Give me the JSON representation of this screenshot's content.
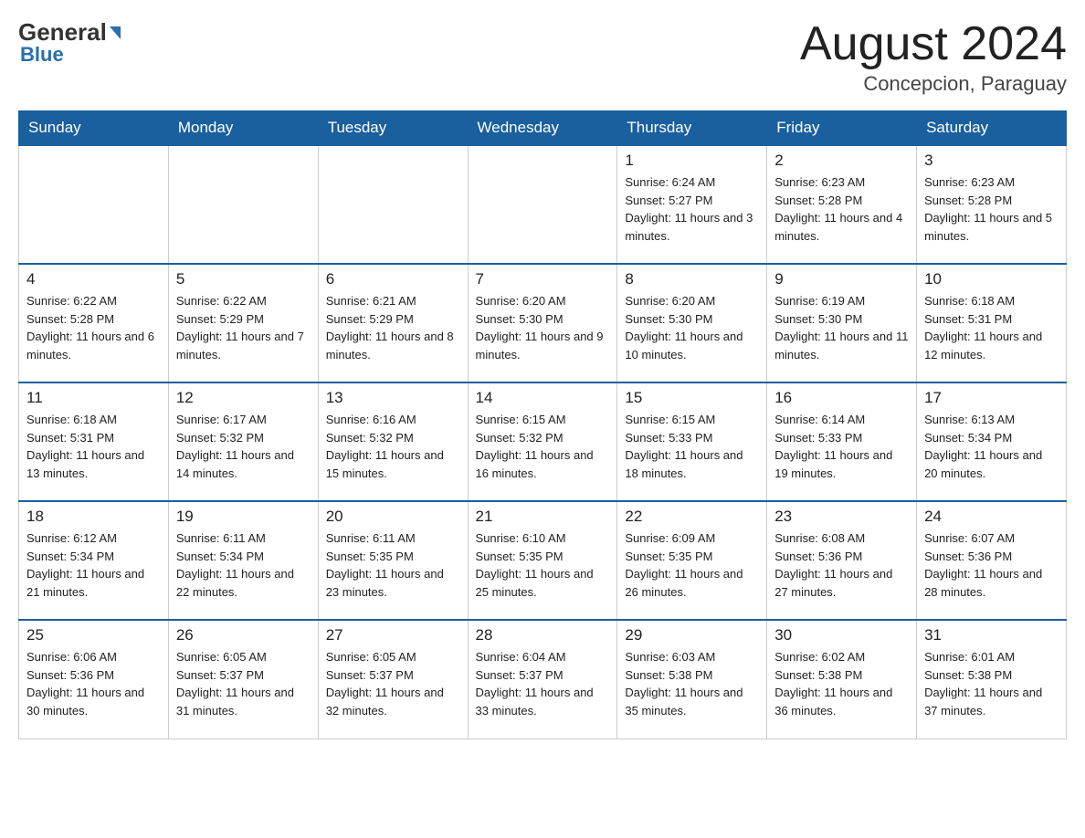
{
  "header": {
    "logo_general": "General",
    "logo_blue": "Blue",
    "month_year": "August 2024",
    "location": "Concepcion, Paraguay"
  },
  "weekdays": [
    "Sunday",
    "Monday",
    "Tuesday",
    "Wednesday",
    "Thursday",
    "Friday",
    "Saturday"
  ],
  "weeks": [
    [
      {
        "day": "",
        "sunrise": "",
        "sunset": "",
        "daylight": ""
      },
      {
        "day": "",
        "sunrise": "",
        "sunset": "",
        "daylight": ""
      },
      {
        "day": "",
        "sunrise": "",
        "sunset": "",
        "daylight": ""
      },
      {
        "day": "",
        "sunrise": "",
        "sunset": "",
        "daylight": ""
      },
      {
        "day": "1",
        "sunrise": "Sunrise: 6:24 AM",
        "sunset": "Sunset: 5:27 PM",
        "daylight": "Daylight: 11 hours and 3 minutes."
      },
      {
        "day": "2",
        "sunrise": "Sunrise: 6:23 AM",
        "sunset": "Sunset: 5:28 PM",
        "daylight": "Daylight: 11 hours and 4 minutes."
      },
      {
        "day": "3",
        "sunrise": "Sunrise: 6:23 AM",
        "sunset": "Sunset: 5:28 PM",
        "daylight": "Daylight: 11 hours and 5 minutes."
      }
    ],
    [
      {
        "day": "4",
        "sunrise": "Sunrise: 6:22 AM",
        "sunset": "Sunset: 5:28 PM",
        "daylight": "Daylight: 11 hours and 6 minutes."
      },
      {
        "day": "5",
        "sunrise": "Sunrise: 6:22 AM",
        "sunset": "Sunset: 5:29 PM",
        "daylight": "Daylight: 11 hours and 7 minutes."
      },
      {
        "day": "6",
        "sunrise": "Sunrise: 6:21 AM",
        "sunset": "Sunset: 5:29 PM",
        "daylight": "Daylight: 11 hours and 8 minutes."
      },
      {
        "day": "7",
        "sunrise": "Sunrise: 6:20 AM",
        "sunset": "Sunset: 5:30 PM",
        "daylight": "Daylight: 11 hours and 9 minutes."
      },
      {
        "day": "8",
        "sunrise": "Sunrise: 6:20 AM",
        "sunset": "Sunset: 5:30 PM",
        "daylight": "Daylight: 11 hours and 10 minutes."
      },
      {
        "day": "9",
        "sunrise": "Sunrise: 6:19 AM",
        "sunset": "Sunset: 5:30 PM",
        "daylight": "Daylight: 11 hours and 11 minutes."
      },
      {
        "day": "10",
        "sunrise": "Sunrise: 6:18 AM",
        "sunset": "Sunset: 5:31 PM",
        "daylight": "Daylight: 11 hours and 12 minutes."
      }
    ],
    [
      {
        "day": "11",
        "sunrise": "Sunrise: 6:18 AM",
        "sunset": "Sunset: 5:31 PM",
        "daylight": "Daylight: 11 hours and 13 minutes."
      },
      {
        "day": "12",
        "sunrise": "Sunrise: 6:17 AM",
        "sunset": "Sunset: 5:32 PM",
        "daylight": "Daylight: 11 hours and 14 minutes."
      },
      {
        "day": "13",
        "sunrise": "Sunrise: 6:16 AM",
        "sunset": "Sunset: 5:32 PM",
        "daylight": "Daylight: 11 hours and 15 minutes."
      },
      {
        "day": "14",
        "sunrise": "Sunrise: 6:15 AM",
        "sunset": "Sunset: 5:32 PM",
        "daylight": "Daylight: 11 hours and 16 minutes."
      },
      {
        "day": "15",
        "sunrise": "Sunrise: 6:15 AM",
        "sunset": "Sunset: 5:33 PM",
        "daylight": "Daylight: 11 hours and 18 minutes."
      },
      {
        "day": "16",
        "sunrise": "Sunrise: 6:14 AM",
        "sunset": "Sunset: 5:33 PM",
        "daylight": "Daylight: 11 hours and 19 minutes."
      },
      {
        "day": "17",
        "sunrise": "Sunrise: 6:13 AM",
        "sunset": "Sunset: 5:34 PM",
        "daylight": "Daylight: 11 hours and 20 minutes."
      }
    ],
    [
      {
        "day": "18",
        "sunrise": "Sunrise: 6:12 AM",
        "sunset": "Sunset: 5:34 PM",
        "daylight": "Daylight: 11 hours and 21 minutes."
      },
      {
        "day": "19",
        "sunrise": "Sunrise: 6:11 AM",
        "sunset": "Sunset: 5:34 PM",
        "daylight": "Daylight: 11 hours and 22 minutes."
      },
      {
        "day": "20",
        "sunrise": "Sunrise: 6:11 AM",
        "sunset": "Sunset: 5:35 PM",
        "daylight": "Daylight: 11 hours and 23 minutes."
      },
      {
        "day": "21",
        "sunrise": "Sunrise: 6:10 AM",
        "sunset": "Sunset: 5:35 PM",
        "daylight": "Daylight: 11 hours and 25 minutes."
      },
      {
        "day": "22",
        "sunrise": "Sunrise: 6:09 AM",
        "sunset": "Sunset: 5:35 PM",
        "daylight": "Daylight: 11 hours and 26 minutes."
      },
      {
        "day": "23",
        "sunrise": "Sunrise: 6:08 AM",
        "sunset": "Sunset: 5:36 PM",
        "daylight": "Daylight: 11 hours and 27 minutes."
      },
      {
        "day": "24",
        "sunrise": "Sunrise: 6:07 AM",
        "sunset": "Sunset: 5:36 PM",
        "daylight": "Daylight: 11 hours and 28 minutes."
      }
    ],
    [
      {
        "day": "25",
        "sunrise": "Sunrise: 6:06 AM",
        "sunset": "Sunset: 5:36 PM",
        "daylight": "Daylight: 11 hours and 30 minutes."
      },
      {
        "day": "26",
        "sunrise": "Sunrise: 6:05 AM",
        "sunset": "Sunset: 5:37 PM",
        "daylight": "Daylight: 11 hours and 31 minutes."
      },
      {
        "day": "27",
        "sunrise": "Sunrise: 6:05 AM",
        "sunset": "Sunset: 5:37 PM",
        "daylight": "Daylight: 11 hours and 32 minutes."
      },
      {
        "day": "28",
        "sunrise": "Sunrise: 6:04 AM",
        "sunset": "Sunset: 5:37 PM",
        "daylight": "Daylight: 11 hours and 33 minutes."
      },
      {
        "day": "29",
        "sunrise": "Sunrise: 6:03 AM",
        "sunset": "Sunset: 5:38 PM",
        "daylight": "Daylight: 11 hours and 35 minutes."
      },
      {
        "day": "30",
        "sunrise": "Sunrise: 6:02 AM",
        "sunset": "Sunset: 5:38 PM",
        "daylight": "Daylight: 11 hours and 36 minutes."
      },
      {
        "day": "31",
        "sunrise": "Sunrise: 6:01 AM",
        "sunset": "Sunset: 5:38 PM",
        "daylight": "Daylight: 11 hours and 37 minutes."
      }
    ]
  ]
}
